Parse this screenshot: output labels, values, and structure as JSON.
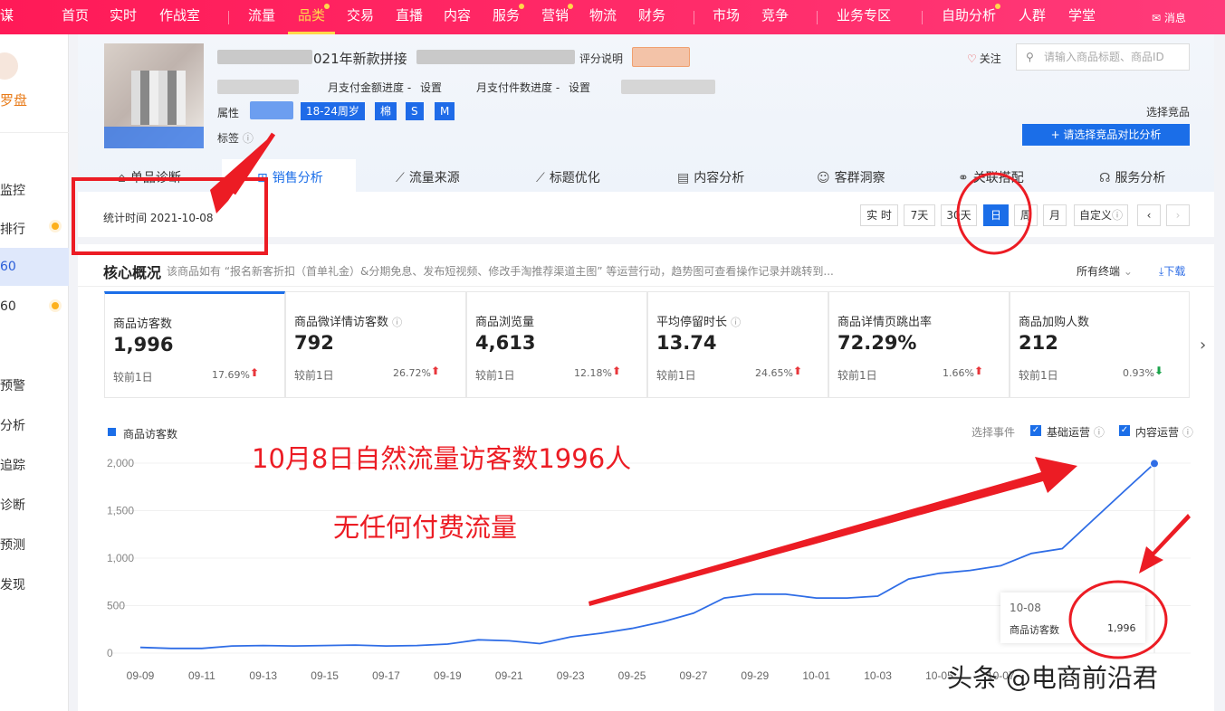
{
  "topnav": {
    "brand_fragment": "谋",
    "items": [
      "首页",
      "实时",
      "作战室",
      "流量",
      "品类",
      "交易",
      "直播",
      "内容",
      "服务",
      "营销",
      "物流",
      "财务",
      "市场",
      "竞争",
      "业务专区",
      "自助分析",
      "人群",
      "学堂"
    ],
    "message": "消息"
  },
  "sidebar": {
    "logo_fragment": "罗盘",
    "items": [
      "监控",
      "排行",
      "60",
      "60",
      "预警",
      "分析",
      "追踪",
      "诊断",
      "预测",
      "发现"
    ]
  },
  "product": {
    "title_visible": "021年新款拼接",
    "rating_link": "评分说明",
    "pay_amount_progress": "月支付金额进度 -",
    "pay_count_progress": "月支付件数进度 -",
    "set": "设置",
    "attr_label": "属性",
    "attr_tags": [
      "18-24周岁",
      "棉",
      "S",
      "M"
    ],
    "tag_label": "标签",
    "tag_value": "-",
    "follow": "关注",
    "search_placeholder": "请输入商品标题、商品ID",
    "pick_competitor": "选择竞品",
    "compare_button": "+ 请选择竞品对比分析"
  },
  "tabs": [
    "单品诊断",
    "销售分析",
    "流量来源",
    "标题优化",
    "内容分析",
    "客群洞察",
    "关联搭配",
    "服务分析"
  ],
  "stat_time": "统计时间 2021-10-08",
  "time_buttons": [
    "实 时",
    "7天",
    "30天",
    "日",
    "周",
    "月",
    "自定义"
  ],
  "core": {
    "title": "核心概况",
    "desc": "该商品如有 “报名新客折扣（首单礼金）&分期免息、发布短视频、修改手淘推荐渠道主图” 等运营行动，趋势图可查看操作记录并跳转到...",
    "all_terminals": "所有终端",
    "download": "下载",
    "compare_label": "较前1日"
  },
  "metrics": [
    {
      "title": "商品访客数",
      "value": "1,996",
      "change": "17.69%",
      "dir": "up"
    },
    {
      "title": "商品微详情访客数",
      "value": "792",
      "change": "26.72%",
      "dir": "up"
    },
    {
      "title": "商品浏览量",
      "value": "4,613",
      "change": "12.18%",
      "dir": "up"
    },
    {
      "title": "平均停留时长",
      "value": "13.74",
      "change": "24.65%",
      "dir": "up"
    },
    {
      "title": "商品详情页跳出率",
      "value": "72.29%",
      "change": "1.66%",
      "dir": "up"
    },
    {
      "title": "商品加购人数",
      "value": "212",
      "change": "0.93%",
      "dir": "down"
    }
  ],
  "chart_legend": "商品访客数",
  "events": {
    "label": "选择事件",
    "basic": "基础运营",
    "content": "内容运营"
  },
  "chart_data": {
    "type": "line",
    "series": [
      {
        "name": "商品访客数",
        "values": [
          60,
          50,
          50,
          75,
          80,
          75,
          80,
          85,
          75,
          80,
          95,
          140,
          130,
          100,
          170,
          210,
          260,
          330,
          420,
          580,
          620,
          620,
          580,
          580,
          600,
          780,
          840,
          870,
          920,
          1050,
          1100,
          1400,
          1700,
          1996
        ]
      }
    ],
    "x_ticks": [
      "09-09",
      "09-11",
      "09-13",
      "09-15",
      "09-17",
      "09-19",
      "09-21",
      "09-23",
      "09-25",
      "09-27",
      "09-29",
      "10-01",
      "10-03",
      "10-05",
      "10-07"
    ],
    "y_ticks": [
      "0",
      "500",
      "1,000",
      "1,500",
      "2,000"
    ],
    "ylim": [
      0,
      2000
    ],
    "tooltip": {
      "date": "10-08",
      "label": "商品访客数",
      "value": "1,996"
    }
  },
  "annotations": {
    "line1": "10月8日自然流量访客数1996人",
    "line2": "无任何付费流量",
    "watermark": "头条 @电商前沿君"
  }
}
